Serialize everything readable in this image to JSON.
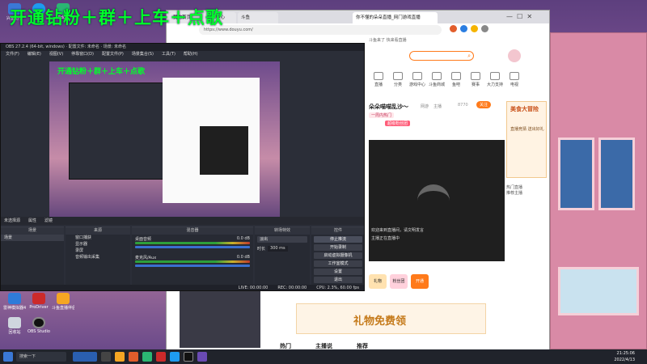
{
  "overlay": {
    "text": "开通钻粉＋群＋上车＋点歌",
    "mini_text": "开通钻粉＋群＋上车＋点歌"
  },
  "desktop": {
    "icons": [
      {
        "label": "兴奋助手"
      },
      {
        "label": "KK"
      },
      {
        "label": "Edge"
      },
      {
        "label": "雷神模拟器4"
      },
      {
        "label": "ProDriver"
      },
      {
        "label": "斗鱼直播伴侣"
      },
      {
        "label": "回收站"
      },
      {
        "label": "OBS Studio"
      }
    ]
  },
  "browser": {
    "tabs": [
      {
        "label": "我的首页"
      },
      {
        "label": "个人中心"
      },
      {
        "label": "斗鱼"
      },
      {
        "label": "你不懂的朵朵直播_网门游戏直播"
      }
    ],
    "address": "https://www.douyu.com/",
    "topbar_note": "斗鱼来了 快来看直播",
    "search_placeholder": "",
    "nav": [
      {
        "label": "直播"
      },
      {
        "label": "分类"
      },
      {
        "label": "游戏中心"
      },
      {
        "label": "斗鱼商城"
      },
      {
        "label": "鱼吧"
      },
      {
        "label": "赛事"
      },
      {
        "label": "大力支持"
      },
      {
        "label": "电视"
      }
    ],
    "streamer": {
      "title": "朵朵喵喵乱沙～",
      "cat": "网游",
      "tag": "主播",
      "follow_count": "8770",
      "follow_label": "关注",
      "badges": [
        "一周内热门",
        "超级粉丝团"
      ]
    },
    "event": {
      "title": "美食大冒险",
      "desc": "直播竞猜 送出好礼"
    },
    "danmaku": [
      "欢迎来到直播间，请文明发言",
      "主播正在直播中"
    ],
    "gift_bar": [
      "礼物",
      "粉丝团",
      "开通"
    ],
    "banner": {
      "text": "礼物免费领"
    },
    "bottom_tabs": [
      {
        "label": "热门"
      },
      {
        "label": "主播说"
      },
      {
        "label": "推荐"
      }
    ],
    "side_list": [
      "热门直播",
      "推荐主播"
    ]
  },
  "obs": {
    "title": "OBS 27.2.4 (64-bit, windows) · 配置文件: 未命名 · 场景: 未命名",
    "menu": [
      "文件(F)",
      "编辑(E)",
      "视图(V)",
      "停靠窗口(D)",
      "配置文件(P)",
      "场景集合(S)",
      "工具(T)",
      "帮助(H)"
    ],
    "no_source": "未选择源",
    "props_label": "属性",
    "filters_label": "滤镜",
    "panels": {
      "scenes": "场景",
      "sources": "来源",
      "mixer": "混音器",
      "transitions": "转场特效",
      "controls": "控件"
    },
    "scenes": [
      "场景"
    ],
    "sources": [
      "窗口捕获",
      "显示器",
      "录屏",
      "音频输出采集"
    ],
    "mixer": [
      {
        "name": "桌面音频",
        "db": "0.0 dB"
      },
      {
        "name": "麦克风/Aux",
        "db": "0.0 dB"
      }
    ],
    "transition": {
      "mode": "淡出",
      "duration_label": "时长",
      "duration": "300 ms"
    },
    "controls": [
      "停止推流",
      "开始录制",
      "启动虚拟摄像机",
      "工作室模式",
      "设置",
      "退出"
    ],
    "status": {
      "live": "LIVE: 00:00:00",
      "rec": "REC: 00:00:00",
      "cpu": "CPU: 2.3%, 60.00 fps"
    }
  },
  "taskbar": {
    "time": "21:25:06",
    "date": "2022/4/13",
    "start_label": "搜索一下"
  }
}
